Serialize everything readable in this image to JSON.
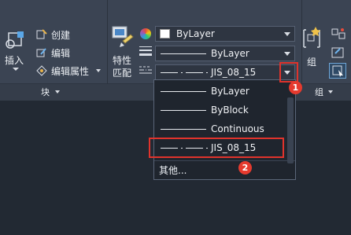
{
  "ribbon": {
    "insert_label": "插入",
    "create_label": "创建",
    "edit_label": "编辑",
    "edit_attr_label": "编辑属性",
    "block_panel_label": "块",
    "match_props_line1": "特性",
    "match_props_line2": "匹配",
    "group_label": "组",
    "group_panel_label": "组"
  },
  "properties": {
    "color_value": "ByLayer",
    "lineweight_value": "ByLayer",
    "linetype_value": "JIS_08_15"
  },
  "dropdown": {
    "items": [
      {
        "label": "ByLayer",
        "style": "solid"
      },
      {
        "label": "ByBlock",
        "style": "solid"
      },
      {
        "label": "Continuous",
        "style": "solid"
      },
      {
        "label": "JIS_08_15",
        "style": "dashdot"
      }
    ],
    "other_label": "其他..."
  },
  "annotations": {
    "badge1": "1",
    "badge2": "2"
  },
  "colors": {
    "ribbon_bg": "#3b4453",
    "canvas_bg": "#222933",
    "highlight_red": "#e0332c"
  }
}
